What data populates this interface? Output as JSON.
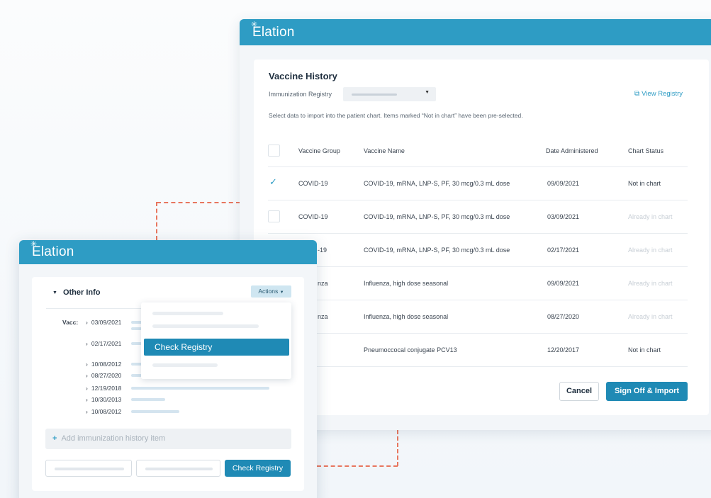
{
  "back_window": {
    "logo": "Elation",
    "title": "Vaccine History",
    "registry_label": "Immunization Registry",
    "view_registry": "View Registry",
    "instructions": "Select data to import into the patient chart. Items marked “Not in chart” have been pre-selected.",
    "columns": [
      "Vaccine Group",
      "Vaccine Name",
      "Date Administered",
      "Chart Status"
    ],
    "rows": [
      {
        "group": "COVID-19",
        "name": "COVID-19, mRNA, LNP-S, PF, 30 mcg/0.3 mL dose",
        "date": "09/09/2021",
        "status": "Not in chart",
        "checked": true
      },
      {
        "group": "COVID-19",
        "name": "COVID-19, mRNA, LNP-S, PF, 30 mcg/0.3 mL dose",
        "date": "03/09/2021",
        "status": "Already in chart",
        "checked": false
      },
      {
        "group": "-19",
        "name": "COVID-19, mRNA, LNP-S, PF, 30 mcg/0.3 mL dose",
        "date": "02/17/2021",
        "status": "Already in chart",
        "checked": false
      },
      {
        "group": "nza",
        "name": "Influenza, high dose seasonal",
        "date": "09/09/2021",
        "status": "Already in chart",
        "checked": false
      },
      {
        "group": "nza",
        "name": "Influenza, high dose seasonal",
        "date": "08/27/2020",
        "status": "Already in chart",
        "checked": false
      },
      {
        "group": "",
        "name": "Pneumoccocal conjugate PCV13",
        "date": "12/20/2017",
        "status": "Not in chart",
        "checked": false
      }
    ],
    "cancel_label": "Cancel",
    "sign_off_label": "Sign Off & Import"
  },
  "front_window": {
    "logo": "Elation",
    "section_title": "Other Info",
    "actions_label": "Actions",
    "vacc_label": "Vacc:",
    "dates": [
      "03/09/2021",
      "02/17/2021",
      "10/08/2012",
      "08/27/2020",
      "12/19/2018",
      "10/30/2013",
      "10/08/2012"
    ],
    "menu_item": "Check Registry",
    "add_placeholder": "Add immunization history item",
    "check_registry_button": "Check Registry"
  },
  "colors": {
    "brand": "#2e9cc4",
    "primary_button": "#1f8ab5",
    "connector": "#e8765f"
  },
  "icons": [
    "sparkle-logo-icon",
    "caret-down-icon",
    "external-link-icon",
    "check-icon",
    "chevron-right-icon",
    "plus-icon"
  ]
}
